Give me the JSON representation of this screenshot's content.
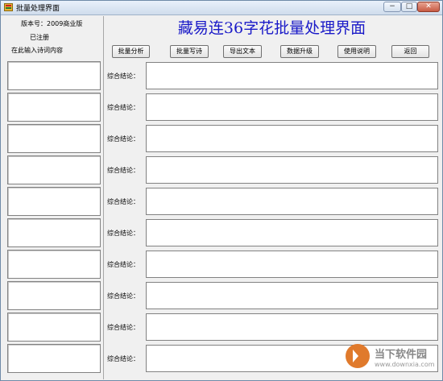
{
  "window": {
    "title": "批量处理界面"
  },
  "left": {
    "version": "版本号：2009商业版",
    "registered": "已注册",
    "prompt": "在此输入诗词内容",
    "poem_fields": [
      "",
      "",
      "",
      "",
      "",
      "",
      "",
      "",
      "",
      ""
    ]
  },
  "main": {
    "title": "藏易连36字花批量处理界面",
    "toolbar": [
      "批量分析",
      "批量写诗",
      "导出文本",
      "数据升级",
      "使用说明",
      "返回"
    ],
    "result_label": "综合结论：",
    "results": [
      "",
      "",
      "",
      "",
      "",
      "",
      "",
      "",
      "",
      ""
    ]
  },
  "watermark": {
    "name": "当下软件园",
    "url": "www.downxia.com"
  }
}
